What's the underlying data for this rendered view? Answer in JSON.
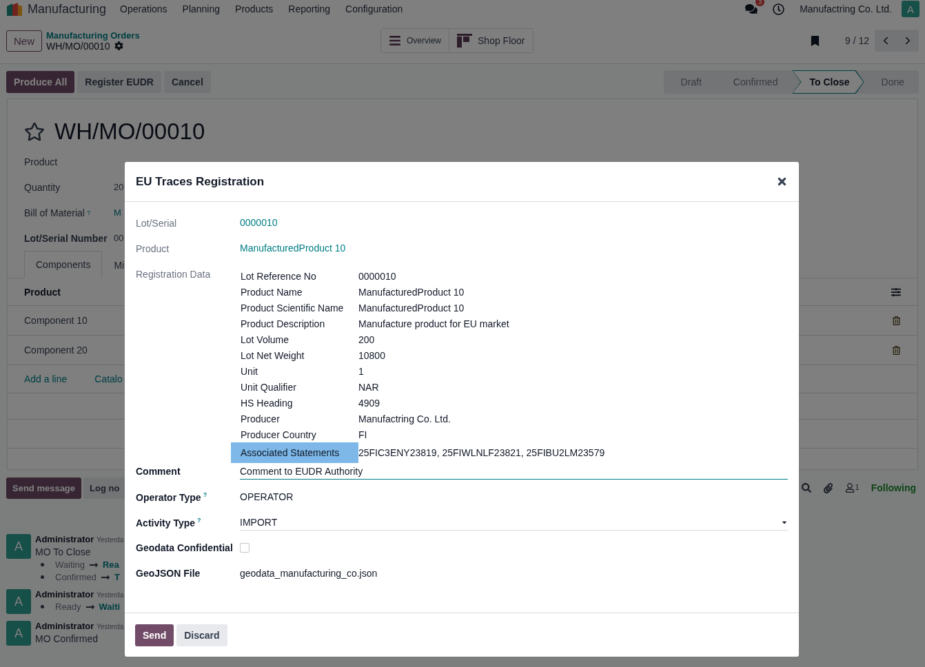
{
  "topbar": {
    "app_name": "Manufacturing",
    "menu": [
      "Operations",
      "Planning",
      "Products",
      "Reporting",
      "Configuration"
    ],
    "notification_count": "3",
    "company": "Manufactring Co. Ltd.",
    "avatar": "A"
  },
  "control_bar": {
    "new_button": "New",
    "breadcrumb": "Manufacturing Orders",
    "record": "WH/MO/00010",
    "views": [
      {
        "label": "Overview",
        "kind": "list"
      },
      {
        "label": "Shop Floor",
        "kind": "floor"
      }
    ],
    "pager": "9 / 12"
  },
  "actions": [
    {
      "label": "Produce All",
      "primary": true
    },
    {
      "label": "Register EUDR",
      "primary": false
    },
    {
      "label": "Cancel",
      "primary": false
    }
  ],
  "stages": [
    {
      "label": "Draft",
      "selected": false
    },
    {
      "label": "Confirmed",
      "selected": false
    },
    {
      "label": "To Close",
      "selected": true
    },
    {
      "label": "Done",
      "selected": false
    }
  ],
  "form": {
    "title": "WH/MO/00010",
    "starred": false,
    "fields": [
      {
        "label": "Product",
        "bold": false
      },
      {
        "label": "Quantity",
        "value": "20",
        "kind": "text",
        "bold": false
      },
      {
        "label": "Bill of Material",
        "help": "?",
        "value": "M",
        "kind": "link",
        "bold": false
      },
      {
        "label": "Lot/Serial Number",
        "value": "00",
        "kind": "text",
        "bold": true
      }
    ],
    "tabs": [
      {
        "label": "Components",
        "selected": true
      },
      {
        "label": "Mi",
        "selected": false
      }
    ],
    "table": {
      "column": "Product",
      "rows": [
        "Component 10",
        "Component 20"
      ]
    },
    "add_links": [
      "Add a line",
      "Catalo"
    ]
  },
  "chatter": {
    "buttons": [
      {
        "label": "Send message",
        "primary": true
      },
      {
        "label": "Log no",
        "primary": false
      }
    ],
    "followers": "1",
    "follow_label": "Following",
    "messages": [
      {
        "avatar": "A",
        "author": "Administrator",
        "time": "Yesterda",
        "body": "MO To Close",
        "changes": [
          {
            "from": "Waiting",
            "to": "Rea"
          },
          {
            "from": "Confirmed",
            "to": "T"
          }
        ]
      },
      {
        "avatar": "A",
        "author": "Administrator",
        "time": "Yesterda",
        "changes": [
          {
            "from": "Ready",
            "to": "Waiti"
          }
        ]
      },
      {
        "avatar": "A",
        "author": "Administrator",
        "time": "Yesterda",
        "body": "MO Confirmed"
      }
    ]
  },
  "dialog": {
    "title": "EU Traces Registration",
    "rows": [
      {
        "label": "Lot/Serial",
        "kind": "link",
        "value": "0000010"
      },
      {
        "label": "Product",
        "kind": "link",
        "value": "ManufacturedProduct 10"
      },
      {
        "label": "Registration Data",
        "kind": "table",
        "entries": [
          {
            "key": "Lot Reference No",
            "value": "0000010",
            "highlighted": false
          },
          {
            "key": "Product Name",
            "value": "ManufacturedProduct 10",
            "highlighted": false
          },
          {
            "key": "Product Scientific Name",
            "value": "ManufacturedProduct 10",
            "highlighted": false
          },
          {
            "key": "Product Description",
            "value": "Manufacture product for EU market",
            "highlighted": false
          },
          {
            "key": "Lot Volume",
            "value": "200",
            "highlighted": false
          },
          {
            "key": "Lot Net Weight",
            "value": "10800",
            "highlighted": false
          },
          {
            "key": "Unit",
            "value": "1",
            "highlighted": false
          },
          {
            "key": "Unit Qualifier",
            "value": "NAR",
            "highlighted": false
          },
          {
            "key": "HS Heading",
            "value": "4909",
            "highlighted": false
          },
          {
            "key": "Producer",
            "value": "Manufactring Co. Ltd.",
            "highlighted": false
          },
          {
            "key": "Producer Country",
            "value": "FI",
            "highlighted": false
          },
          {
            "key": "Associated Statements",
            "value": "25FIC3ENY23819, 25FIWLNLF23821, 25FIBU2LM23579",
            "highlighted": true
          }
        ]
      },
      {
        "label": "Comment",
        "kind": "input",
        "value": "Comment to EUDR Authority",
        "focused": true
      },
      {
        "label": "Operator Type",
        "help": "?",
        "kind": "text",
        "value": "OPERATOR"
      },
      {
        "label": "Activity Type",
        "help": "?",
        "kind": "select",
        "value": "IMPORT"
      },
      {
        "label": "Geodata Confidential",
        "kind": "checkbox",
        "checked": false
      },
      {
        "label": "GeoJSON File",
        "kind": "text",
        "value": "geodata_manufacturing_co.json"
      }
    ],
    "buttons": [
      {
        "label": "Send",
        "primary": true
      },
      {
        "label": "Discard",
        "primary": false
      }
    ]
  }
}
